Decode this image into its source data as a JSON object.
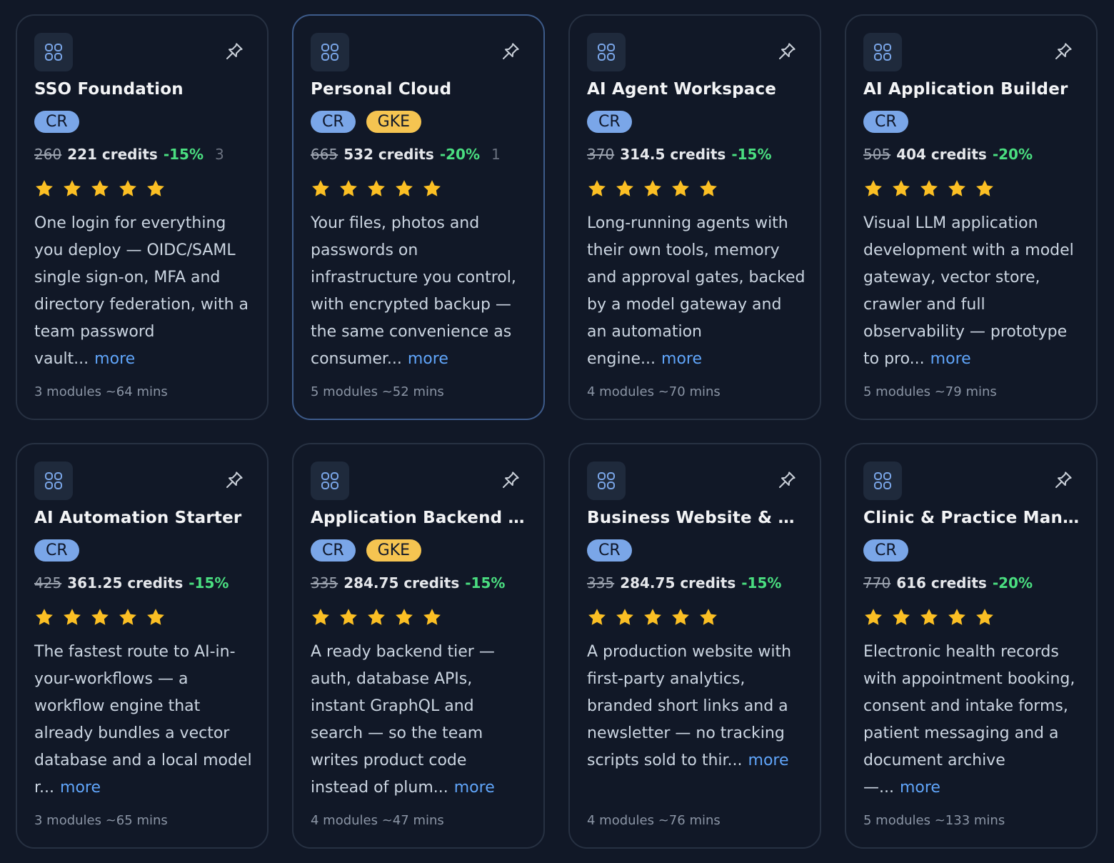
{
  "more_label": "more",
  "colors": {
    "background": "#111827",
    "card_border": "#273142",
    "selected_border": "#3d5b8a",
    "badge_cr": "#7aa6e8",
    "badge_gke": "#f5c451",
    "discount": "#4ade80",
    "link": "#60a5fa",
    "star": "#fbbf24"
  },
  "cards": [
    {
      "title": "SSO Foundation",
      "badges": [
        "CR"
      ],
      "old_price": "260",
      "price": "221 credits",
      "discount": "-15%",
      "count": "3",
      "rating": 5,
      "description": "One login for everything you deploy — OIDC/SAML single sign-on, MFA and directory federation, with a team password vault...",
      "meta": "3 modules ~64 mins",
      "selected": false
    },
    {
      "title": "Personal Cloud",
      "badges": [
        "CR",
        "GKE"
      ],
      "old_price": "665",
      "price": "532 credits",
      "discount": "-20%",
      "count": "1",
      "rating": 5,
      "description": "Your files, photos and passwords on infrastructure you control, with encrypted backup — the same convenience as consumer...",
      "meta": "5 modules ~52 mins",
      "selected": true
    },
    {
      "title": "AI Agent Workspace",
      "badges": [
        "CR"
      ],
      "old_price": "370",
      "price": "314.5 credits",
      "discount": "-15%",
      "count": "",
      "rating": 5,
      "description": "Long-running agents with their own tools, memory and approval gates, backed by a model gateway and an automation engine...",
      "meta": "4 modules ~70 mins",
      "selected": false
    },
    {
      "title": "AI Application Builder",
      "badges": [
        "CR"
      ],
      "old_price": "505",
      "price": "404 credits",
      "discount": "-20%",
      "count": "",
      "rating": 5,
      "description": "Visual LLM application development with a model gateway, vector store, crawler and full observability — prototype to pro...",
      "meta": "5 modules ~79 mins",
      "selected": false
    },
    {
      "title": "AI Automation Starter",
      "badges": [
        "CR"
      ],
      "old_price": "425",
      "price": "361.25 credits",
      "discount": "-15%",
      "count": "",
      "rating": 5,
      "description": "The fastest route to AI-in-your-workflows — a workflow engine that already bundles a vector database and a local model r...",
      "meta": "3 modules ~65 mins",
      "selected": false
    },
    {
      "title": "Application Backend Ser...",
      "badges": [
        "CR",
        "GKE"
      ],
      "old_price": "335",
      "price": "284.75 credits",
      "discount": "-15%",
      "count": "",
      "rating": 5,
      "description": "A ready backend tier — auth, database APIs, instant GraphQL and search — so the team writes product code instead of plum...",
      "meta": "4 modules ~47 mins",
      "selected": false
    },
    {
      "title": "Business Website & Blog",
      "badges": [
        "CR"
      ],
      "old_price": "335",
      "price": "284.75 credits",
      "discount": "-15%",
      "count": "",
      "rating": 5,
      "description": "A production website with first-party analytics, branded short links and a newsletter — no tracking scripts sold to thir...",
      "meta": "4 modules ~76 mins",
      "selected": false
    },
    {
      "title": "Clinic & Practice Manag...",
      "badges": [
        "CR"
      ],
      "old_price": "770",
      "price": "616 credits",
      "discount": "-20%",
      "count": "",
      "rating": 5,
      "description": "Electronic health records with appointment booking, consent and intake forms, patient messaging and a document archive —...",
      "meta": "5 modules ~133 mins",
      "selected": false
    }
  ]
}
